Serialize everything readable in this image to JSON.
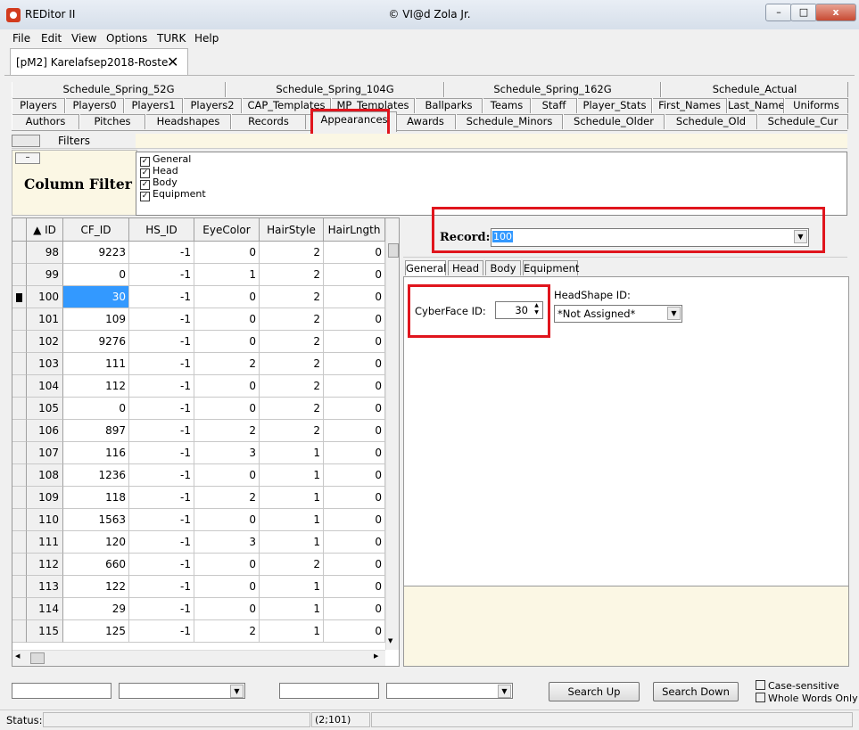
{
  "window": {
    "app_title": "REDitor II",
    "center_title": "© VI@d Zola Jr.",
    "minimize": "–",
    "maximize": "□",
    "close": "x"
  },
  "menu": [
    "File",
    "Edit",
    "View",
    "Options",
    "TURK",
    "Help"
  ],
  "doc_tab": {
    "label": "[pM2] Karelafsep2018-Roste",
    "close": "✕"
  },
  "tabs_row1": [
    "Schedule_Spring_52G",
    "Schedule_Spring_104G",
    "Schedule_Spring_162G",
    "Schedule_Actual"
  ],
  "tabs_row2": [
    "Players",
    "Players0",
    "Players1",
    "Players2",
    "CAP_Templates",
    "MP_Templates",
    "Ballparks",
    "Teams",
    "Staff",
    "Player_Stats",
    "First_Names",
    "Last_Names",
    "Uniforms"
  ],
  "tabs_row3": [
    "Authors",
    "Pitches",
    "Headshapes",
    "Records",
    "Appearances",
    "Awards",
    "Schedule_Minors",
    "Schedule_Older",
    "Schedule_Old",
    "Schedule_Cur"
  ],
  "filters": {
    "label": "Filters",
    "collapse": "–",
    "column_filter_label": "Column Filter",
    "items": [
      {
        "label": "General",
        "checked": true
      },
      {
        "label": "Head",
        "checked": true
      },
      {
        "label": "Body",
        "checked": true
      },
      {
        "label": "Equipment",
        "checked": true
      }
    ]
  },
  "grid": {
    "headers": [
      "▲ ID",
      "CF_ID",
      "HS_ID",
      "EyeColor",
      "HairStyle",
      "HairLngth"
    ],
    "selected_row_index": 2,
    "rows": [
      [
        "98",
        "9223",
        "-1",
        "0",
        "2",
        "0"
      ],
      [
        "99",
        "0",
        "-1",
        "1",
        "2",
        "0"
      ],
      [
        "100",
        "30",
        "-1",
        "0",
        "2",
        "0"
      ],
      [
        "101",
        "109",
        "-1",
        "0",
        "2",
        "0"
      ],
      [
        "102",
        "9276",
        "-1",
        "0",
        "2",
        "0"
      ],
      [
        "103",
        "111",
        "-1",
        "2",
        "2",
        "0"
      ],
      [
        "104",
        "112",
        "-1",
        "0",
        "2",
        "0"
      ],
      [
        "105",
        "0",
        "-1",
        "0",
        "2",
        "0"
      ],
      [
        "106",
        "897",
        "-1",
        "2",
        "2",
        "0"
      ],
      [
        "107",
        "116",
        "-1",
        "3",
        "1",
        "0"
      ],
      [
        "108",
        "1236",
        "-1",
        "0",
        "1",
        "0"
      ],
      [
        "109",
        "118",
        "-1",
        "2",
        "1",
        "0"
      ],
      [
        "110",
        "1563",
        "-1",
        "0",
        "1",
        "0"
      ],
      [
        "111",
        "120",
        "-1",
        "3",
        "1",
        "0"
      ],
      [
        "112",
        "660",
        "-1",
        "0",
        "2",
        "0"
      ],
      [
        "113",
        "122",
        "-1",
        "0",
        "1",
        "0"
      ],
      [
        "114",
        "29",
        "-1",
        "0",
        "1",
        "0"
      ],
      [
        "115",
        "125",
        "-1",
        "2",
        "1",
        "0"
      ]
    ]
  },
  "record": {
    "label": "Record:",
    "value": "100"
  },
  "inner_tabs": [
    "General",
    "Head",
    "Body",
    "Equipment"
  ],
  "general": {
    "cyberface_label": "CyberFace ID:",
    "cyberface_value": "30",
    "headshape_label": "HeadShape ID:",
    "headshape_value": "*Not Assigned*"
  },
  "search": {
    "search_up": "Search Up",
    "search_down": "Search Down",
    "case_sensitive": "Case-sensitive",
    "whole_words": "Whole Words Only"
  },
  "status": {
    "label": "Status:",
    "position": "(2;101)"
  },
  "colors": {
    "highlight": "#e0151d",
    "selection": "#3399ff",
    "panel_yellow": "#fbf7e4"
  }
}
